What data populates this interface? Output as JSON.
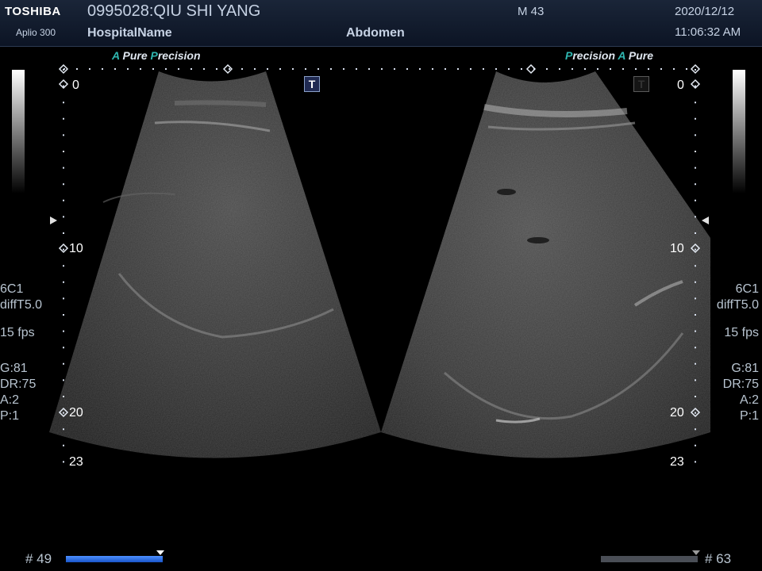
{
  "header": {
    "brand": "TOSHIBA",
    "model": "Aplio 300",
    "patient": "0995028:QIU SHI YANG",
    "hospital": "HospitalName",
    "exam": "Abdomen",
    "mi": "M 43",
    "date": "2020/12/12",
    "time": "11:06:32 AM"
  },
  "left_image": {
    "tag_a": "A",
    "tag_pure": "Pure",
    "tag_p": "P",
    "tag_precision": "recision",
    "depth_labels": [
      "0",
      "10",
      "20",
      "23"
    ],
    "transducer": "6C1",
    "filter": "diffT5.0",
    "fps": "15 fps",
    "gain": "G:81",
    "dr": "DR:75",
    "a": "A:2",
    "p": "P:1",
    "frame": "# 49",
    "cine_progress": 1.0,
    "t_icon": "T",
    "t_icon_active": true
  },
  "right_image": {
    "tag_p": "P",
    "tag_precision": "recision",
    "tag_a": "A",
    "tag_pure": "Pure",
    "depth_labels": [
      "0",
      "10",
      "20",
      "23"
    ],
    "transducer": "6C1",
    "filter": "diffT5.0",
    "fps": "15 fps",
    "gain": "G:81",
    "dr": "DR:75",
    "a": "A:2",
    "p": "P:1",
    "frame": "# 63",
    "cine_progress": 1.0,
    "t_icon": "T",
    "t_icon_active": false
  },
  "icons": {
    "left_focus_marker": "triangle-right-icon",
    "right_focus_marker": "triangle-left-icon",
    "t_icon": "trapezoid-mode-icon",
    "grayscale_bar": "grayscale-bar-icon"
  }
}
